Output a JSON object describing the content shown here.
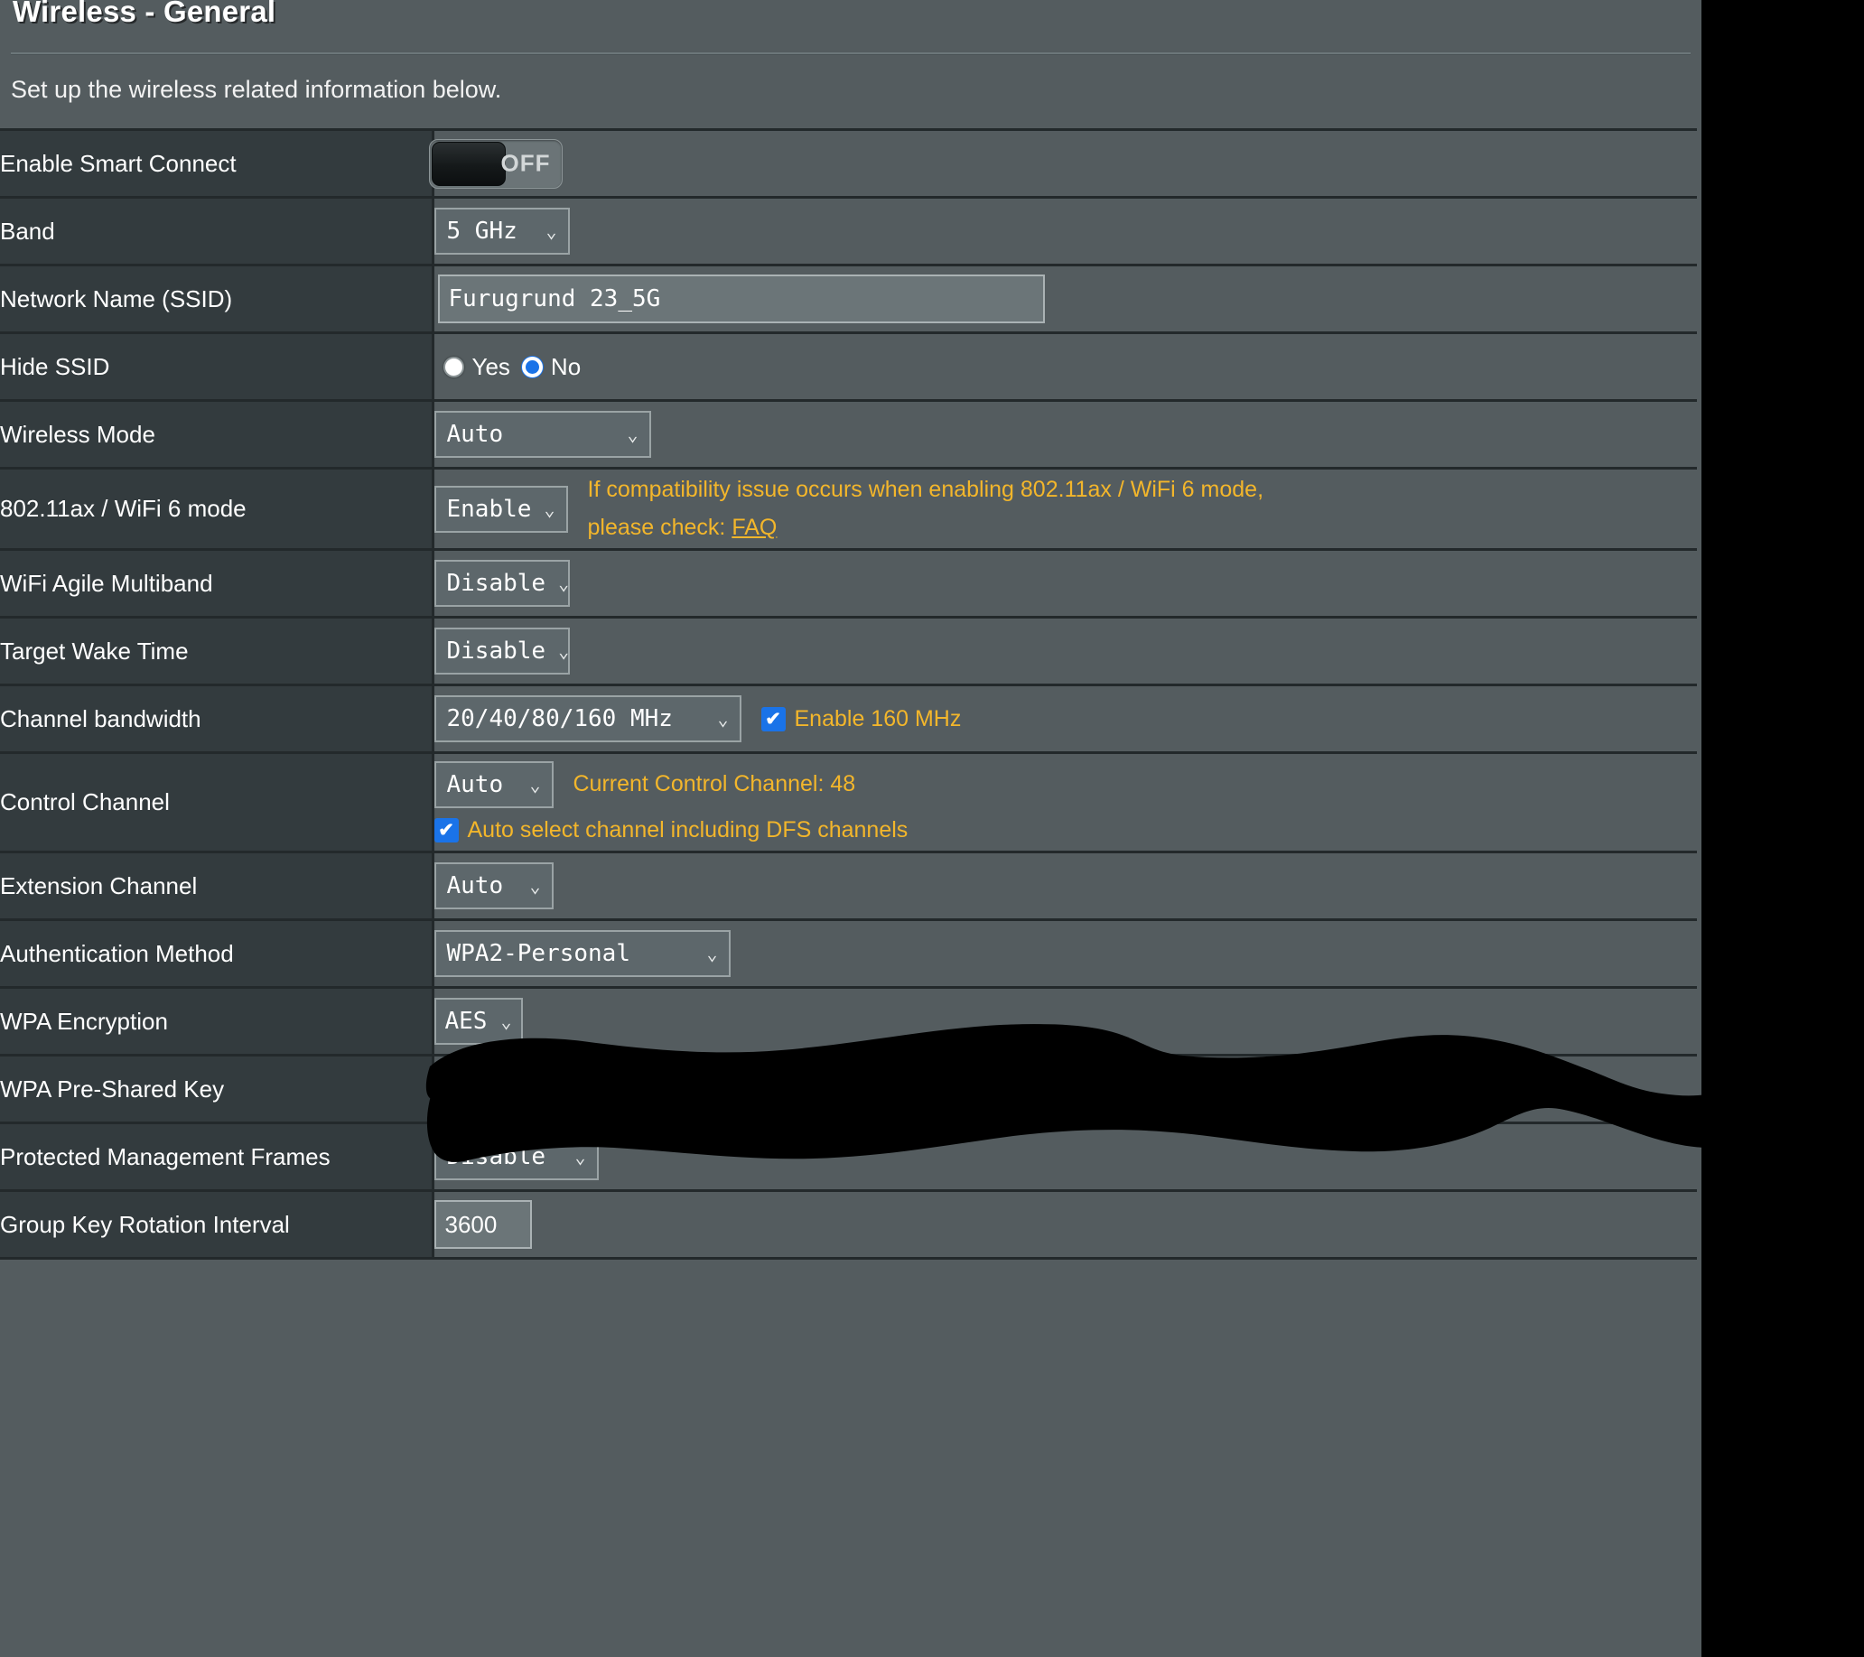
{
  "page": {
    "title": "Wireless - General",
    "description": "Set up the wireless related information below."
  },
  "colors": {
    "panel_bg": "#545c5f",
    "label_bg": "#333b3e",
    "accent_orange": "#f3b62b",
    "accent_blue": "#1a73e8",
    "text": "#ffffff"
  },
  "rows": {
    "smart_connect": {
      "label": "Enable Smart Connect",
      "toggle_state": "OFF"
    },
    "band": {
      "label": "Band",
      "value": "5 GHz"
    },
    "ssid": {
      "label": "Network Name (SSID)",
      "value": "Furugrund 23_5G",
      "placeholder": "Network Name (SSID)"
    },
    "hide_ssid": {
      "label": "Hide SSID",
      "options": [
        "Yes",
        "No"
      ],
      "selected": "No"
    },
    "wireless_mode": {
      "label": "Wireless Mode",
      "value": "Auto"
    },
    "ax_mode": {
      "label": "802.11ax / WiFi 6 mode",
      "value": "Enable",
      "hint_line1": "If compatibility issue occurs when enabling 802.11ax / WiFi 6 mode,",
      "hint_line2_prefix": "please check: ",
      "hint_link": "FAQ"
    },
    "agile_multiband": {
      "label": "WiFi Agile Multiband",
      "value": "Disable"
    },
    "target_wake_time": {
      "label": "Target Wake Time",
      "value": "Disable"
    },
    "channel_bandwidth": {
      "label": "Channel bandwidth",
      "value": "20/40/80/160 MHz",
      "checkbox_label": "Enable 160 MHz",
      "checkbox_checked": "✔"
    },
    "control_channel": {
      "label": "Control Channel",
      "value": "Auto",
      "current_text": "Current Control Channel: 48",
      "checkbox_label": "Auto select channel including DFS channels",
      "checkbox_checked": "✔"
    },
    "extension_channel": {
      "label": "Extension Channel",
      "value": "Auto"
    },
    "auth_method": {
      "label": "Authentication Method",
      "value": "WPA2-Personal"
    },
    "wpa_encryption": {
      "label": "WPA Encryption",
      "value": "AES"
    },
    "wpa_psk": {
      "label": "WPA Pre-Shared Key",
      "value": ""
    },
    "pmf": {
      "label": "Protected Management Frames",
      "value": "Disable"
    },
    "group_key_rotation": {
      "label": "Group Key Rotation Interval",
      "value": "3600"
    }
  }
}
